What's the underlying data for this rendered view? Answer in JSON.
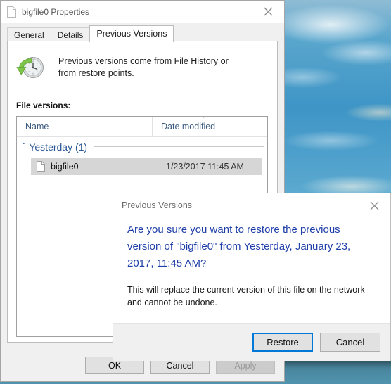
{
  "desktop": {
    "wallpaper_description": "blue sky with clouds over water",
    "colors": {
      "sky_top": "#8fbcd4",
      "sky_mid": "#3e95c6",
      "water": "#4e8ca5"
    }
  },
  "properties_window": {
    "title": "bigfile0 Properties",
    "title_icon": "document-icon",
    "close_label": "✕",
    "tabs": [
      {
        "label": "General",
        "active": false
      },
      {
        "label": "Details",
        "active": false
      },
      {
        "label": "Previous Versions",
        "active": true
      }
    ],
    "panel": {
      "icon": "clock-restore-icon",
      "description": "Previous versions come from File History or from restore points.",
      "file_versions_label": "File versions:",
      "list": {
        "columns": [
          {
            "label": "Name",
            "sorted": false
          },
          {
            "label": "Date modified",
            "sorted": true,
            "sort_indicator": "ˇ"
          }
        ],
        "groups": [
          {
            "label": "Yesterday (1)",
            "chevron": "ˇ",
            "items": [
              {
                "icon": "document-icon",
                "name": "bigfile0",
                "date_modified": "1/23/2017 11:45 AM",
                "selected": true
              }
            ]
          }
        ]
      }
    },
    "buttons": [
      {
        "label": "OK",
        "state": "enabled",
        "default": false
      },
      {
        "label": "Cancel",
        "state": "enabled",
        "default": false
      },
      {
        "label": "Apply",
        "state": "disabled",
        "default": false
      }
    ]
  },
  "dialog": {
    "title": "Previous Versions",
    "close_label": "✕",
    "main_text": "Are you sure you want to restore the previous version of \"bigfile0\" from Yesterday, January 23, 2017, 11:45 AM?",
    "sub_text": "This will replace the current version of this file on the network and cannot be undone.",
    "main_text_color": "#1f3fa8",
    "buttons": [
      {
        "label": "Restore",
        "default": true
      },
      {
        "label": "Cancel",
        "default": false
      }
    ]
  }
}
